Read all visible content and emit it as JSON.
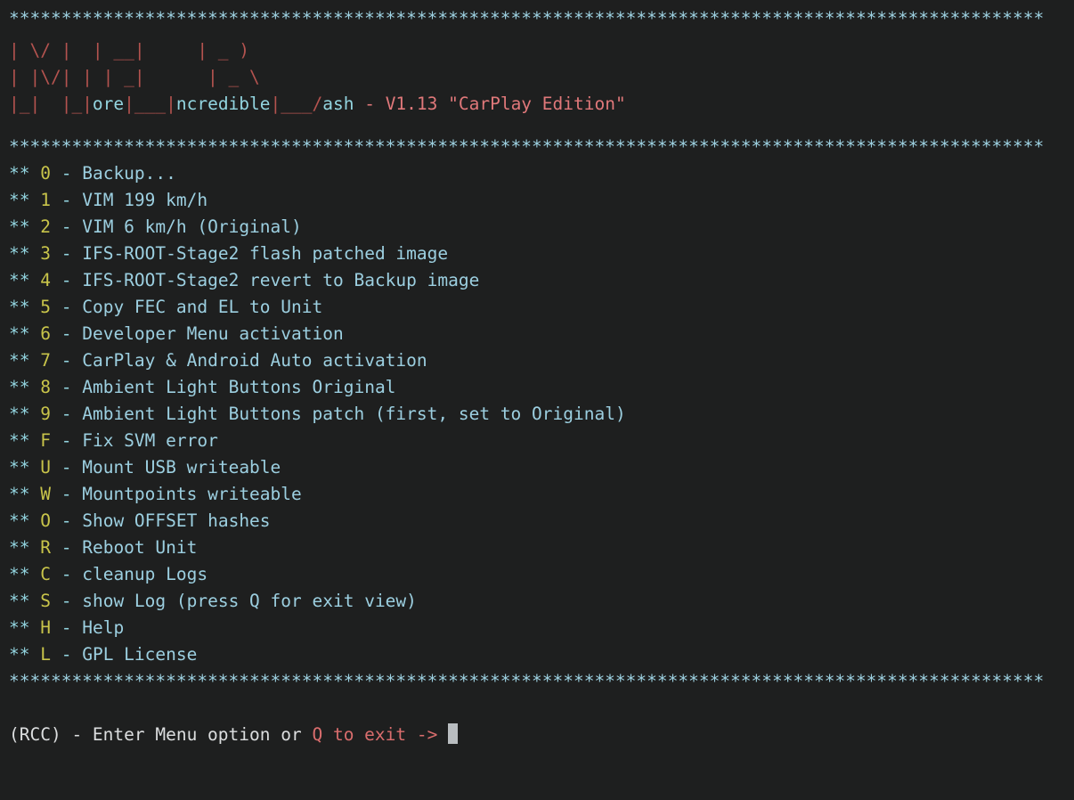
{
  "terminal": {
    "separator_char": "*",
    "separator_count": 99,
    "background_color": "#1e1f1f",
    "colors": {
      "cyan": "#93d5e0",
      "blue": "#9ccfe0",
      "yellow": "#c8c44a",
      "art_red": "#b4534f",
      "salmon": "#e0787a",
      "white": "#dcdedf",
      "cursor": "#b9bdc0"
    }
  },
  "separators": {
    "top": "***************************************************************************************************",
    "below_banner": "***************************************************************************************************",
    "below_menu": "***************************************************************************************************"
  },
  "banner": {
    "line1_art": "| \\/ |  | __|     | _ )",
    "line2_art": "| |\\/| | | _|      | _ \\",
    "line3": {
      "seg1_art": "|_|  |_|",
      "seg2_word": "ore",
      "seg3_art": "|___|",
      "seg4_word": "ncredible",
      "seg5_art": "|___/",
      "seg6_word": "ash",
      "seg7_version": " - V1.13 \"CarPlay Edition\""
    },
    "title_plain": "More Incredible Bash - V1.13 \"CarPlay Edition\""
  },
  "menu": {
    "bullet": "**",
    "dash": "-",
    "items": [
      {
        "key": "0",
        "label": "Backup..."
      },
      {
        "key": "1",
        "label": "VIM 199 km/h"
      },
      {
        "key": "2",
        "label": "VIM 6 km/h (Original)"
      },
      {
        "key": "3",
        "label": "IFS-ROOT-Stage2 flash patched image"
      },
      {
        "key": "4",
        "label": "IFS-ROOT-Stage2 revert to Backup image"
      },
      {
        "key": "5",
        "label": "Copy FEC and EL to Unit"
      },
      {
        "key": "6",
        "label": "Developer Menu activation"
      },
      {
        "key": "7",
        "label": "CarPlay & Android Auto activation"
      },
      {
        "key": "8",
        "label": "Ambient Light Buttons Original"
      },
      {
        "key": "9",
        "label": "Ambient Light Buttons patch (first, set to Original)"
      },
      {
        "key": "F",
        "label": "Fix SVM error"
      },
      {
        "key": "U",
        "label": "Mount USB writeable"
      },
      {
        "key": "W",
        "label": "Mountpoints writeable"
      },
      {
        "key": "O",
        "label": "Show OFFSET hashes"
      },
      {
        "key": "R",
        "label": "Reboot Unit"
      },
      {
        "key": "C",
        "label": "cleanup Logs"
      },
      {
        "key": "S",
        "label": "show Log (press Q for exit view)"
      },
      {
        "key": "H",
        "label": "Help"
      },
      {
        "key": "L",
        "label": "GPL License"
      }
    ]
  },
  "prompt": {
    "prefix": "(RCC) - Enter Menu option or ",
    "exit_hint": "Q to exit ->",
    "trailing_space": " ",
    "input_value": "",
    "full_text": "(RCC) - Enter Menu option or Q to exit -> "
  }
}
